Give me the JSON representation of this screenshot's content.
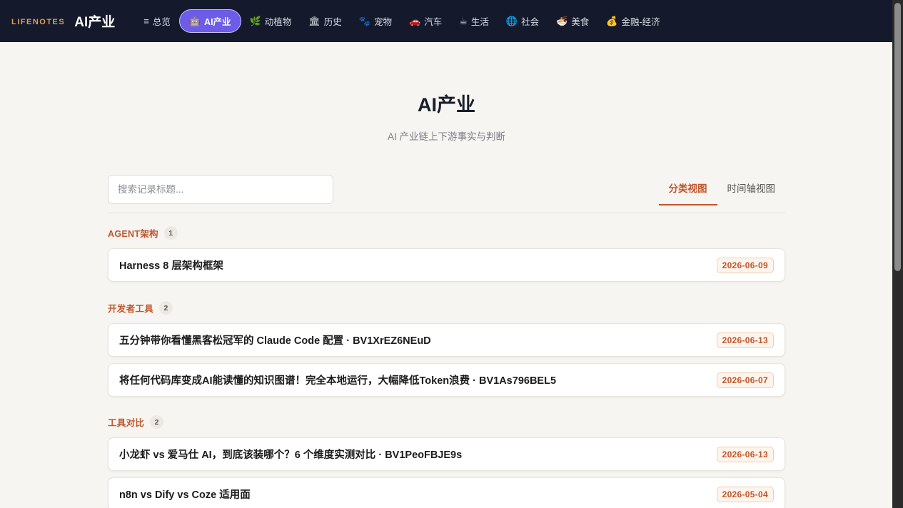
{
  "header": {
    "brand_small": "LIFENOTES",
    "brand_big": "AI产业",
    "nav": [
      {
        "icon": "≡",
        "label": "总览",
        "active": false
      },
      {
        "icon": "🤖",
        "label": "AI产业",
        "active": true
      },
      {
        "icon": "🌿",
        "label": "动植物",
        "active": false
      },
      {
        "icon": "🏛",
        "label": "历史",
        "active": false
      },
      {
        "icon": "🐾",
        "label": "宠物",
        "active": false
      },
      {
        "icon": "🚗",
        "label": "汽车",
        "active": false
      },
      {
        "icon": "☕",
        "label": "生活",
        "active": false
      },
      {
        "icon": "🌐",
        "label": "社会",
        "active": false
      },
      {
        "icon": "🍜",
        "label": "美食",
        "active": false
      },
      {
        "icon": "💰",
        "label": "金融-经济",
        "active": false
      }
    ]
  },
  "page": {
    "title": "AI产业",
    "subtitle": "AI 产业链上下游事实与判断"
  },
  "search": {
    "placeholder": "搜索记录标题...",
    "value": ""
  },
  "tabs": [
    {
      "label": "分类视图",
      "active": true
    },
    {
      "label": "时间轴视图",
      "active": false
    }
  ],
  "sections": [
    {
      "name": "AGENT架构",
      "count": "1",
      "items": [
        {
          "title": "Harness 8 层架构框架",
          "date": "2026-06-09"
        }
      ]
    },
    {
      "name": "开发者工具",
      "count": "2",
      "items": [
        {
          "title": "五分钟带你看懂黑客松冠军的 Claude Code 配置 · BV1XrEZ6NEuD",
          "date": "2026-06-13"
        },
        {
          "title": "将任何代码库变成AI能读懂的知识图谱！完全本地运行，大幅降低Token浪费 · BV1As796BEL5",
          "date": "2026-06-07"
        }
      ]
    },
    {
      "name": "工具对比",
      "count": "2",
      "items": [
        {
          "title": "小龙虾 vs 爱马仕 AI，到底该装哪个？6 个维度实测对比 · BV1PeoFBJE9s",
          "date": "2026-06-13"
        },
        {
          "title": "n8n vs Dify vs Coze 适用面",
          "date": "2026-05-04"
        }
      ]
    }
  ],
  "colors": {
    "accent": "#c0562b",
    "nav_bg": "#141a2c",
    "active_nav": "#6c5ce7"
  }
}
